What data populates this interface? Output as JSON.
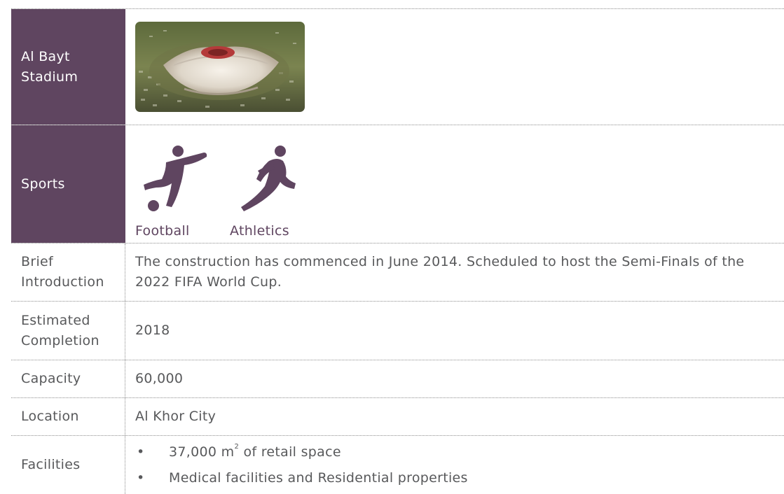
{
  "stadium": {
    "name_line1": "Al Bayt",
    "name_line2": "Stadium",
    "photo_icon": "stadium-render-photo"
  },
  "sports": {
    "label": "Sports",
    "items": [
      {
        "icon": "football-player-icon",
        "label": "Football"
      },
      {
        "icon": "runner-icon",
        "label": "Athletics"
      }
    ],
    "accent_color": "#5f4560"
  },
  "brief": {
    "label_line1": "Brief",
    "label_line2": "Introduction",
    "line1": "The construction has commenced in June 2014. Scheduled to host the Semi-Finals of the",
    "line2": "2022 FIFA World Cup."
  },
  "completion": {
    "label_line1": "Estimated",
    "label_line2": "Completion",
    "value": "2018"
  },
  "capacity": {
    "label": "Capacity",
    "value": "60,000"
  },
  "location": {
    "label": "Location",
    "value": "Al Khor City"
  },
  "facilities": {
    "label": "Facilities",
    "bullet": "•",
    "item1_prefix": "37,000 m",
    "item1_sup": "2",
    "item1_suffix": " of retail space",
    "item2": "Medical facilities and Residential properties"
  }
}
